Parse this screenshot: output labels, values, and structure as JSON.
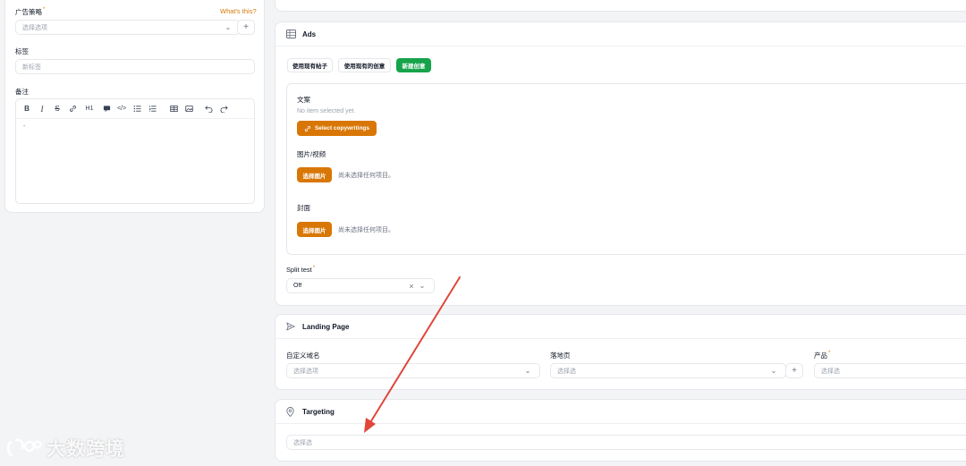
{
  "left_panel": {
    "strategy": {
      "label": "广告策略",
      "help_link": "What's this?",
      "placeholder": "选择选项",
      "add": "+"
    },
    "tags": {
      "label": "标签",
      "placeholder": "新标签"
    },
    "notes": {
      "label": "备注",
      "toolbar": {
        "bold": "B",
        "italic": "I",
        "strike": "S",
        "heading": "H1",
        "code": "</>"
      },
      "content": "-"
    }
  },
  "ads": {
    "title": "Ads",
    "tabs": {
      "use_existing_post": "使用现有帖子",
      "use_existing_creative": "使用现有的创意",
      "new_creative": "新建创意"
    },
    "copywriting": {
      "label": "文案",
      "empty": "No item selected yet.",
      "button": "Select copywritings"
    },
    "media": {
      "label": "图片/视频",
      "button": "选择图片",
      "empty": "尚未选择任何项目。"
    },
    "cover": {
      "label": "封面",
      "button": "选择图片",
      "empty": "尚未选择任何项目。"
    },
    "split_test": {
      "label": "Split test",
      "value": "Off",
      "clear": "×"
    }
  },
  "landing": {
    "title": "Landing Page",
    "domain": {
      "label": "自定义域名",
      "placeholder": "选择选项"
    },
    "page": {
      "label": "落地页",
      "placeholder": "选择选",
      "add": "+"
    },
    "product": {
      "label": "产品",
      "placeholder": "选择选"
    }
  },
  "targeting": {
    "title": "Targeting",
    "placeholder": "选择选"
  },
  "watermark": {
    "text": "大数跨境"
  },
  "colors": {
    "accent_orange": "#d97706",
    "accent_green": "#16a34a",
    "arrow_red": "#e0463a"
  }
}
